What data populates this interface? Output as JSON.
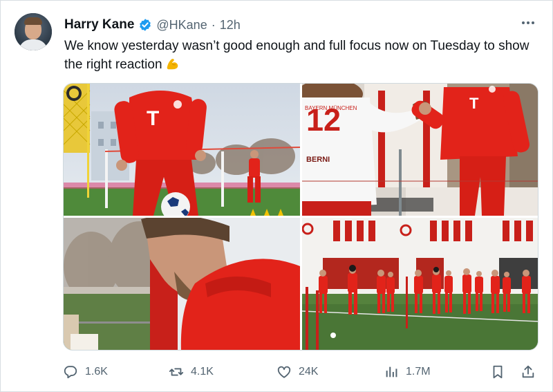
{
  "user": {
    "name": "Harry Kane",
    "handle": "@HKane",
    "separator": "·",
    "time": "12h",
    "verified": true
  },
  "tweet": {
    "text": "We know yesterday wasn’t good enough and full focus now on Tuesday to show the right reaction",
    "emoji": "flexed-biceps"
  },
  "media": {
    "photo1": {
      "shirt_letter": "T"
    },
    "photo2": {
      "shirt_number": "12",
      "shirt_name": "BERNI",
      "shirt_club": "BAYERN MÜNCHEN",
      "shirt_letter": "T"
    },
    "photo3": {},
    "photo4": {}
  },
  "actions": {
    "reply_count": "1.6K",
    "retweet_count": "4.1K",
    "like_count": "24K",
    "view_count": "1.7M"
  },
  "colors": {
    "text_primary": "#0f1419",
    "text_secondary": "#536471",
    "verified_blue": "#1d9bf0",
    "kit_red": "#e2231a"
  }
}
